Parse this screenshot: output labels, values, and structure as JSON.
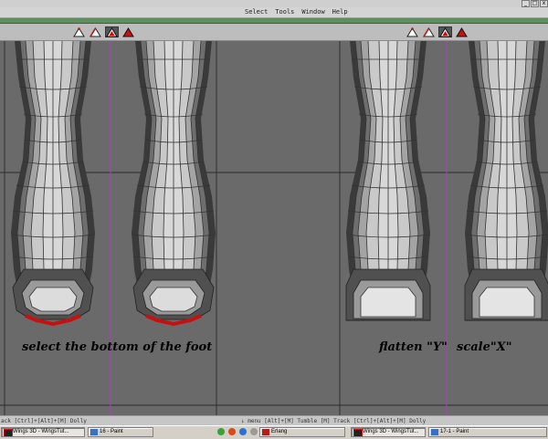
{
  "menubar": {
    "items": [
      "Select",
      "Tools",
      "Window",
      "Help"
    ]
  },
  "window_buttons": [
    "_",
    "□",
    "x"
  ],
  "toolbar": {
    "groups": [
      {
        "icons": [
          "vertex-mode-icon",
          "edge-mode-icon",
          "face-mode-icon",
          "body-mode-icon"
        ],
        "active": 2
      },
      {
        "icons": [
          "vertex-mode-icon",
          "edge-mode-icon",
          "face-mode-icon",
          "body-mode-icon"
        ],
        "active": 2
      }
    ]
  },
  "captions": {
    "select": "select the bottom of the foot",
    "flatten": "flatten \"Y\"",
    "scale": "scale\"X\""
  },
  "statusbar": {
    "left": "ack  [Ctrl]+[Alt]+[M] Dolly",
    "right": "↓ menu  [Alt]+[M] Tumble  [M] Track  [Ctrl]+[Alt]+[M] Dolly"
  },
  "taskbar": {
    "tasks": [
      {
        "label": "Wings 3D - WingsTut...",
        "pressed": true
      },
      {
        "label": "16 - Paint",
        "pressed": false
      },
      {
        "label": "Erlang",
        "pressed": false
      },
      {
        "label": "Wings 3D - WingsTut...",
        "pressed": true
      },
      {
        "label": "17-1 - Paint",
        "pressed": false
      }
    ]
  },
  "colors": {
    "selection": "#c81010",
    "guide_line": "#b23ad0",
    "accent_green": "#5f8d5f"
  }
}
